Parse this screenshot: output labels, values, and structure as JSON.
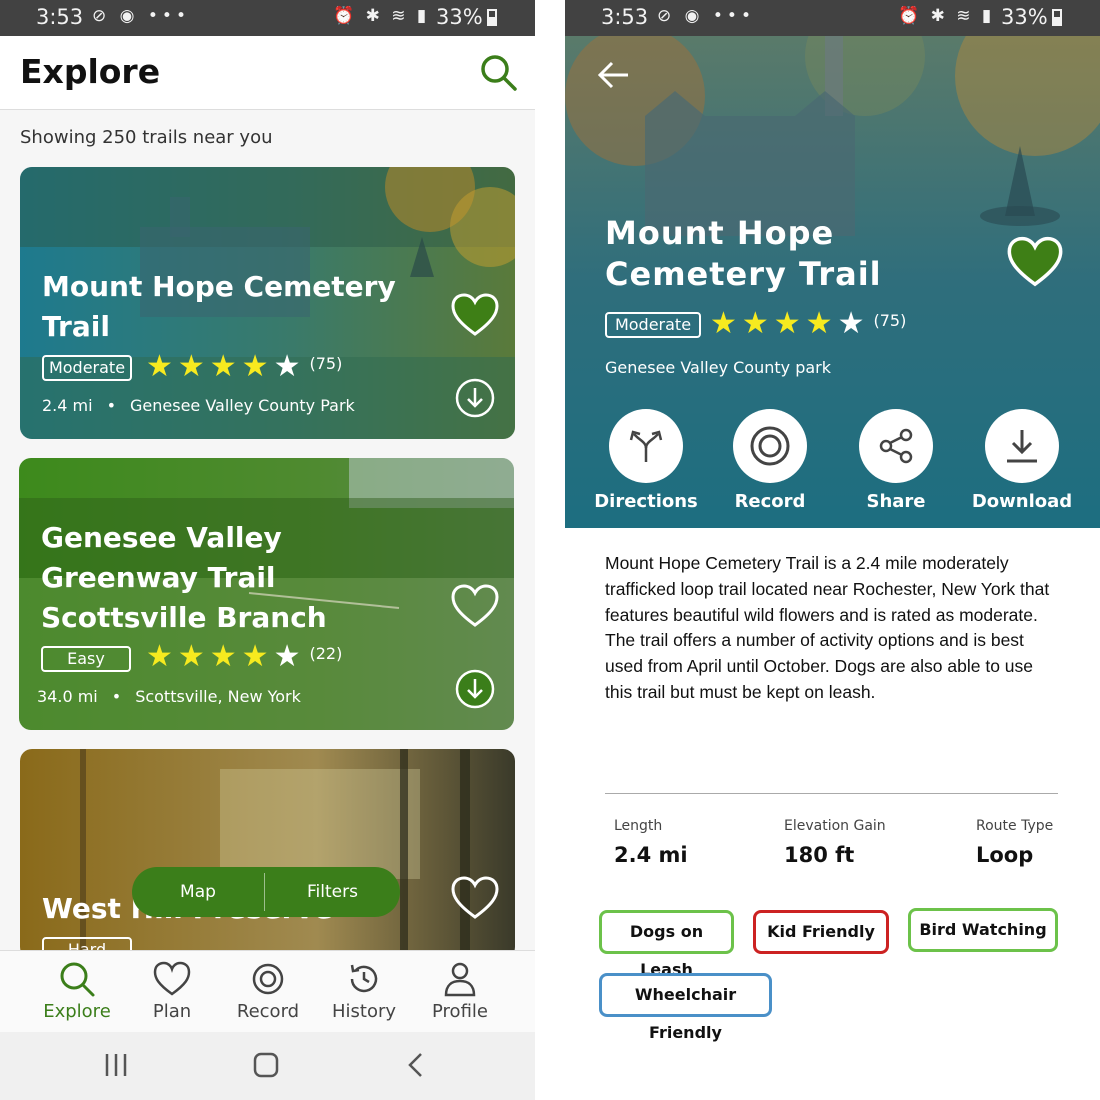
{
  "status_bar": {
    "time": "3:53",
    "battery": "33%"
  },
  "explore": {
    "title": "Explore",
    "showing": "Showing 250 trails near you",
    "cards": [
      {
        "title": "Mount Hope Cemetery Trail",
        "difficulty": "Moderate",
        "rating": 4,
        "reviews": "(75)",
        "distance": "2.4 mi",
        "location": "Genesee Valley County Park",
        "favorited": true
      },
      {
        "title": "Genesee Valley Greenway Trail Scottsville Branch",
        "difficulty": "Easy",
        "rating": 4,
        "reviews": "(22)",
        "distance": "34.0 mi",
        "location": "Scottsville, New York",
        "favorited": false
      },
      {
        "title": "West Hill Preserve",
        "difficulty": "Hard",
        "favorited": false
      }
    ],
    "fab": {
      "map": "Map",
      "filters": "Filters"
    },
    "nav": {
      "explore": "Explore",
      "plan": "Plan",
      "record": "Record",
      "history": "History",
      "profile": "Profile"
    }
  },
  "detail": {
    "title": "Mount Hope Cemetery Trail",
    "difficulty": "Moderate",
    "rating": 4,
    "reviews": "(75)",
    "park": "Genesee Valley County park",
    "actions": {
      "directions": "Directions",
      "record": "Record",
      "share": "Share",
      "download": "Download"
    },
    "description": "Mount Hope Cemetery Trail is a 2.4 mile moderately trafficked loop trail located near Rochester, New York that features beautiful wild flowers and is rated as moderate. The trail offers a number of activity options and is best used from April until October. Dogs are also able to use this trail but must be kept on leash.",
    "stats": {
      "length_label": "Length",
      "length": "2.4 mi",
      "elevation_label": "Elevation Gain",
      "elevation": "180 ft",
      "route_label": "Route Type",
      "route": "Loop"
    },
    "tags": [
      "Dogs on Leash",
      "Kid Friendly",
      "Bird Watching",
      "Wheelchair Friendly"
    ]
  },
  "colors": {
    "brand_green": "#3b7e1a",
    "star_yellow": "#f7ea1f",
    "teal_overlay": "#1d6e80"
  }
}
